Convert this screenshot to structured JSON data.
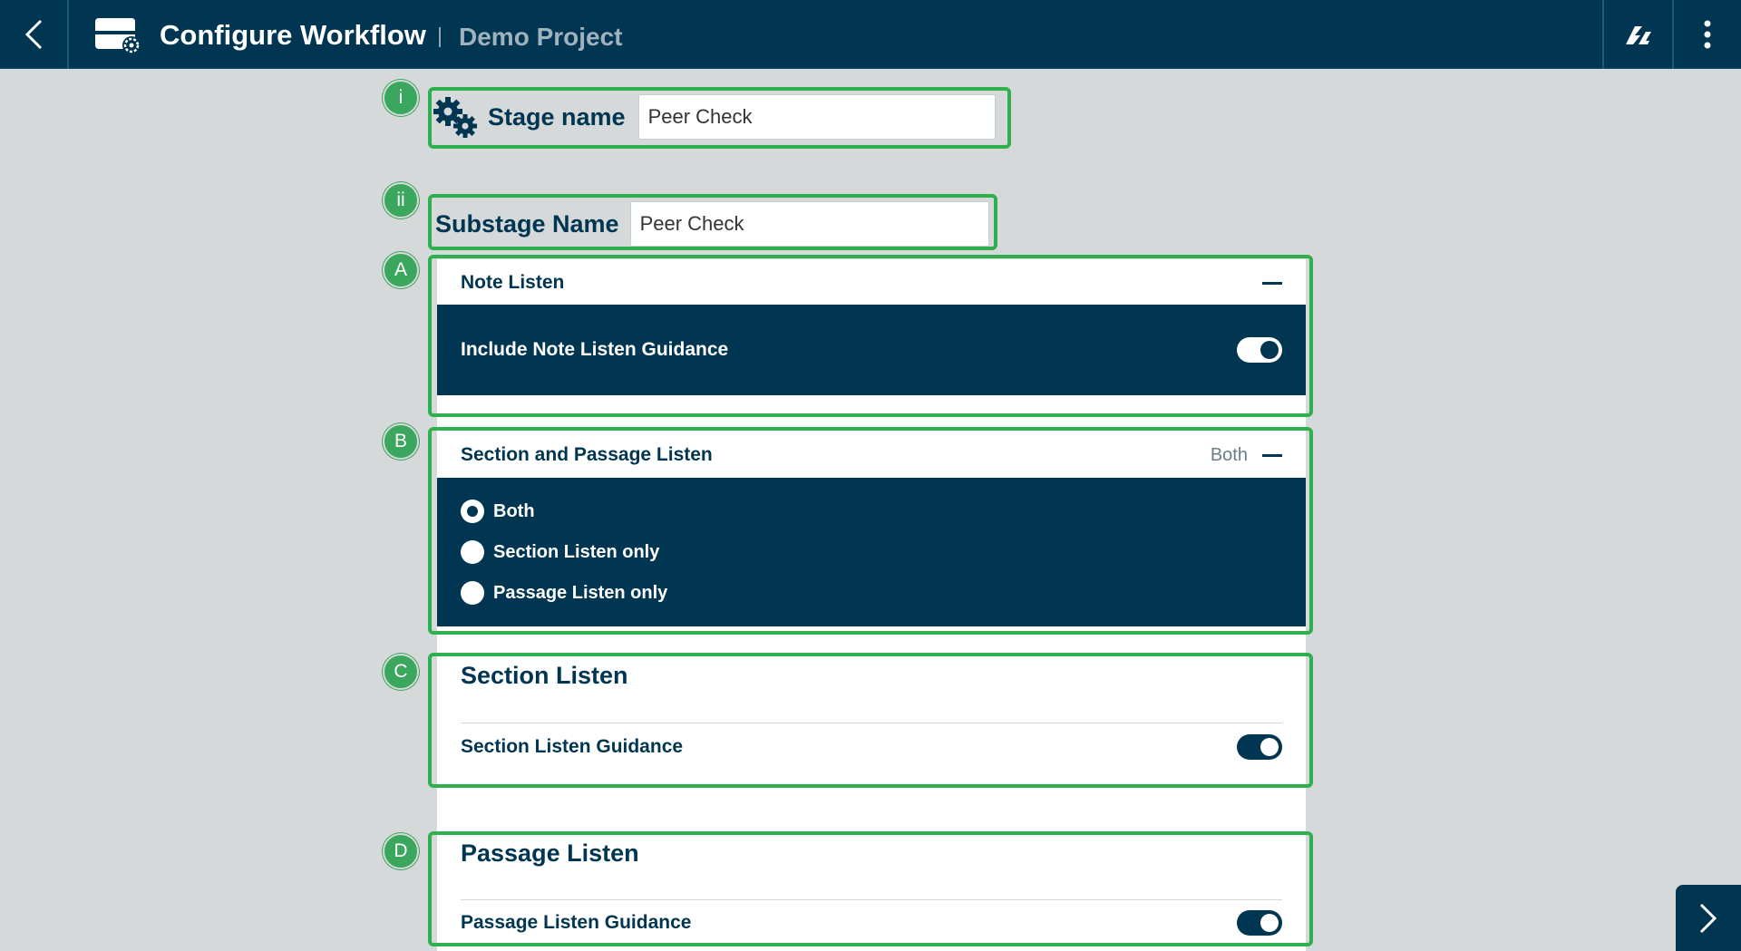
{
  "header": {
    "title": "Configure Workflow",
    "project": "Demo Project",
    "back_icon": "chevron-left-icon",
    "app_icon": "workflow-settings-icon",
    "sync_icon": "sync-icon",
    "menu_icon": "more-vertical-icon"
  },
  "markers": [
    "i",
    "ii",
    "A",
    "B",
    "C",
    "D"
  ],
  "stage": {
    "label": "Stage name",
    "value": "Peer Check",
    "icon": "gears-icon"
  },
  "substage": {
    "label": "Substage Name",
    "value": "Peer Check"
  },
  "note_listen": {
    "title": "Note Listen",
    "guidance_label": "Include Note Listen Guidance",
    "guidance_on": true
  },
  "section_passage": {
    "title": "Section and Passage Listen",
    "summary": "Both",
    "options": [
      "Both",
      "Section Listen only",
      "Passage Listen only"
    ],
    "selected": "Both"
  },
  "section_listen": {
    "title": "Section Listen",
    "guidance_label": "Section Listen Guidance",
    "guidance_on": true
  },
  "passage_listen": {
    "title": "Passage Listen",
    "guidance_label": "Passage Listen Guidance",
    "guidance_on": true
  },
  "colors": {
    "primary": "#003651",
    "highlight": "#2fb04e",
    "background": "#d6d9da"
  }
}
